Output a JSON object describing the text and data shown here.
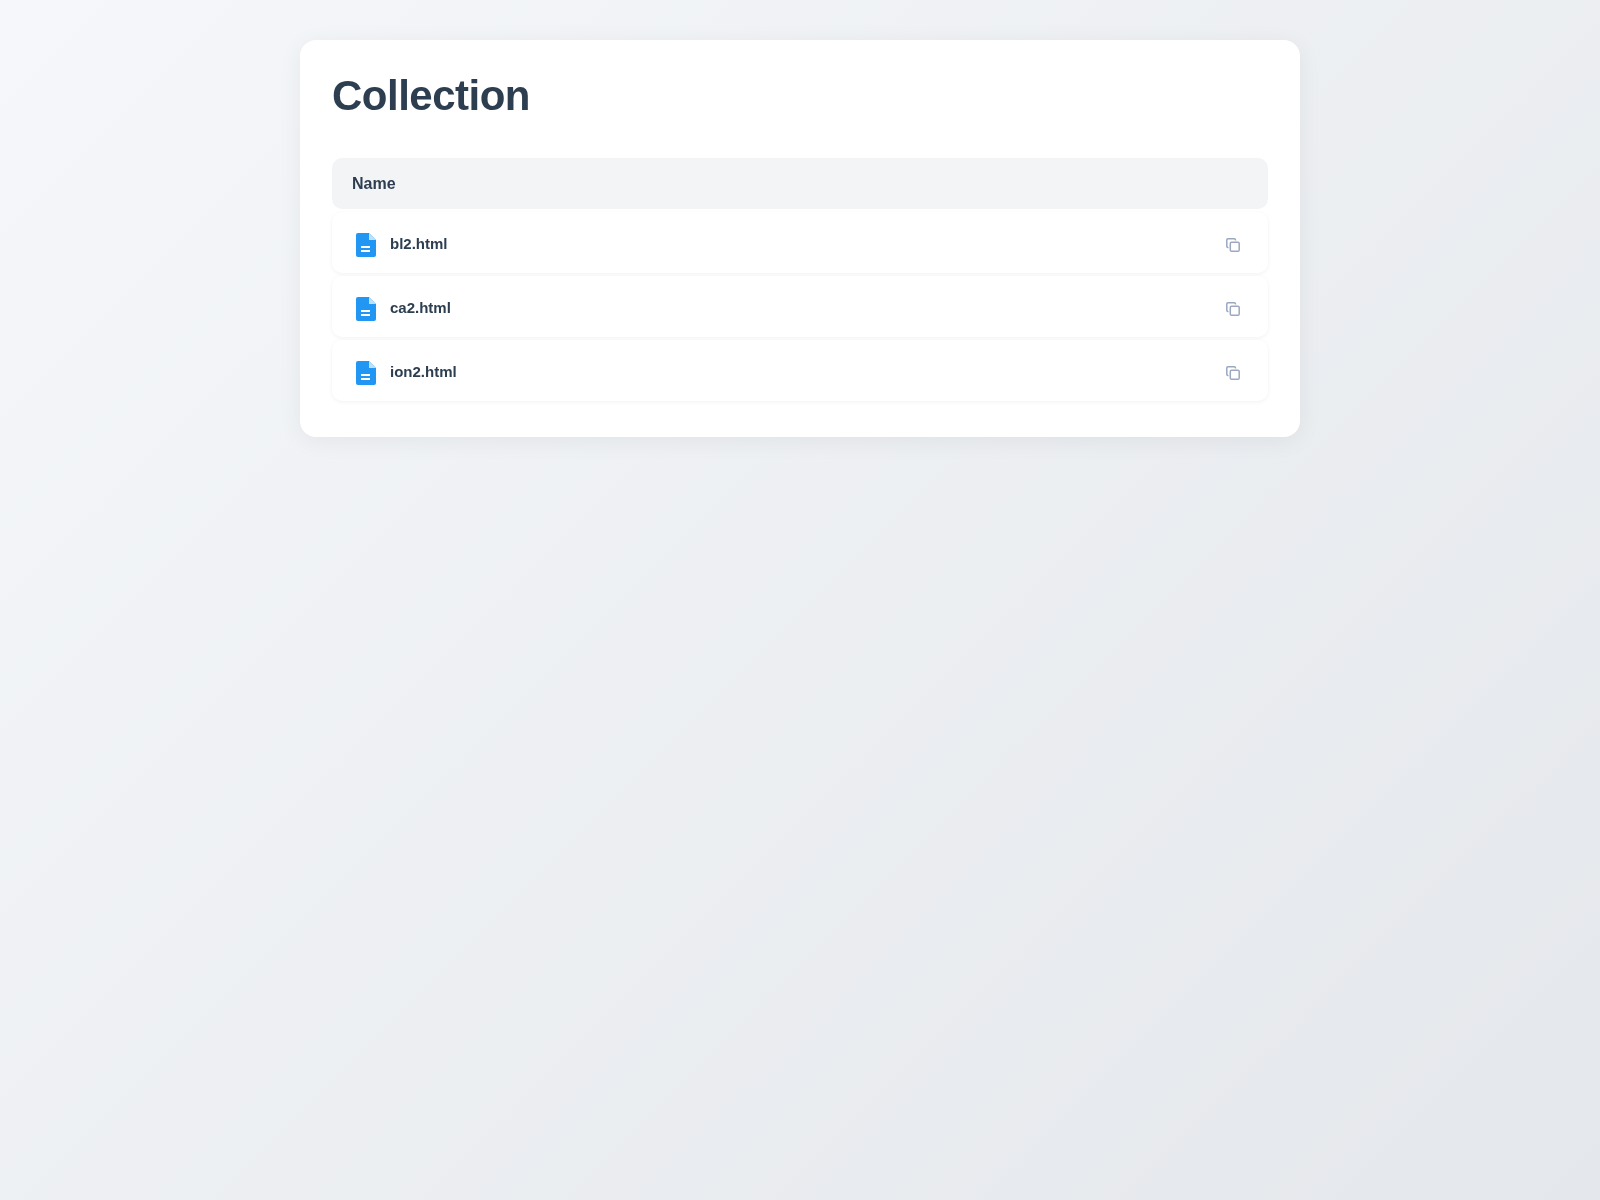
{
  "title": "Collection",
  "table": {
    "columns": [
      "Name"
    ],
    "rows": [
      {
        "name": "bl2.html"
      },
      {
        "name": "ca2.html"
      },
      {
        "name": "ion2.html"
      }
    ]
  }
}
